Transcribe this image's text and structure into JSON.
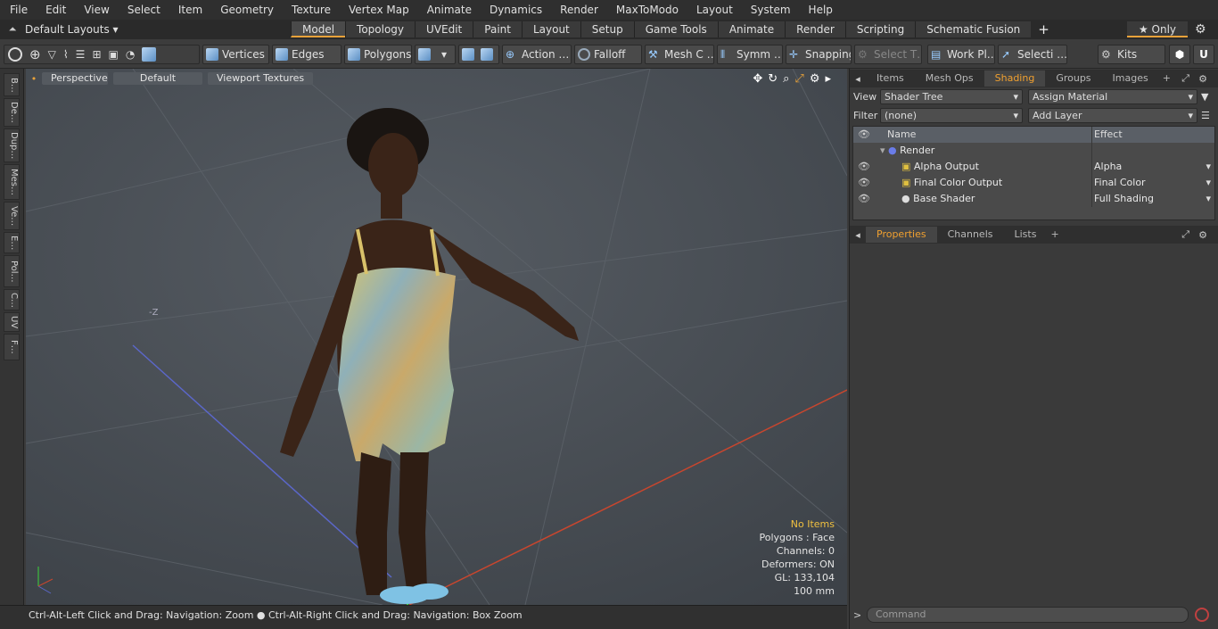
{
  "menu": [
    "File",
    "Edit",
    "View",
    "Select",
    "Item",
    "Geometry",
    "Texture",
    "Vertex Map",
    "Animate",
    "Dynamics",
    "Render",
    "MaxToModo",
    "Layout",
    "System",
    "Help"
  ],
  "layout_selector": "Default Layouts ▾",
  "layout_tabs": [
    "Model",
    "Topology",
    "UVEdit",
    "Paint",
    "Layout",
    "Setup",
    "Game Tools",
    "Animate",
    "Render",
    "Scripting",
    "Schematic Fusion"
  ],
  "layout_tab_add": "+",
  "only_label": "★ Only",
  "toolbar": {
    "vertices": "Vertices",
    "edges": "Edges",
    "polygons": "Polygons",
    "action": "Action …",
    "falloff": "Falloff",
    "mesh": "Mesh C …",
    "symm": "Symm …",
    "snapping": "Snapping",
    "select_t": "Select T…",
    "workplane": "Work Pl…",
    "selecti": "Selecti …",
    "kits": "Kits"
  },
  "left_tabs": [
    "B…",
    "De…",
    "Dup…",
    "Mes…",
    "Ve…",
    "E…",
    "Pol…",
    "C…",
    "UV",
    "F…"
  ],
  "viewport": {
    "projection": "Perspective",
    "style": "Default",
    "textures": "Viewport Textures",
    "axis_label": "-Z",
    "info": {
      "items": "No Items",
      "polygons": "Polygons : Face",
      "channels": "Channels: 0",
      "deformers": "Deformers: ON",
      "gl": "GL: 133,104",
      "units": "100 mm"
    }
  },
  "status": "Ctrl-Alt-Left Click and Drag: Navigation: Zoom ● Ctrl-Alt-Right Click and Drag: Navigation: Box Zoom",
  "panel_tabs": [
    "Items",
    "Mesh Ops",
    "Shading",
    "Groups",
    "Images",
    "+"
  ],
  "shader": {
    "view_label": "View",
    "view_value": "Shader Tree",
    "assign": "Assign Material",
    "filter_label": "Filter",
    "filter_value": "(none)",
    "add_layer": "Add Layer",
    "col_name": "Name",
    "col_effect": "Effect",
    "rows": [
      {
        "name": "Render",
        "effect": ""
      },
      {
        "name": "Alpha Output",
        "effect": "Alpha"
      },
      {
        "name": "Final Color Output",
        "effect": "Final Color"
      },
      {
        "name": "Base Shader",
        "effect": "Full Shading"
      }
    ]
  },
  "props_tabs": [
    "Properties",
    "Channels",
    "Lists",
    "+"
  ],
  "command_placeholder": "Command",
  "colors": {
    "accent": "#e8a23a",
    "selected_tab": "#f0a030",
    "info_highlight": "#f0c040"
  }
}
